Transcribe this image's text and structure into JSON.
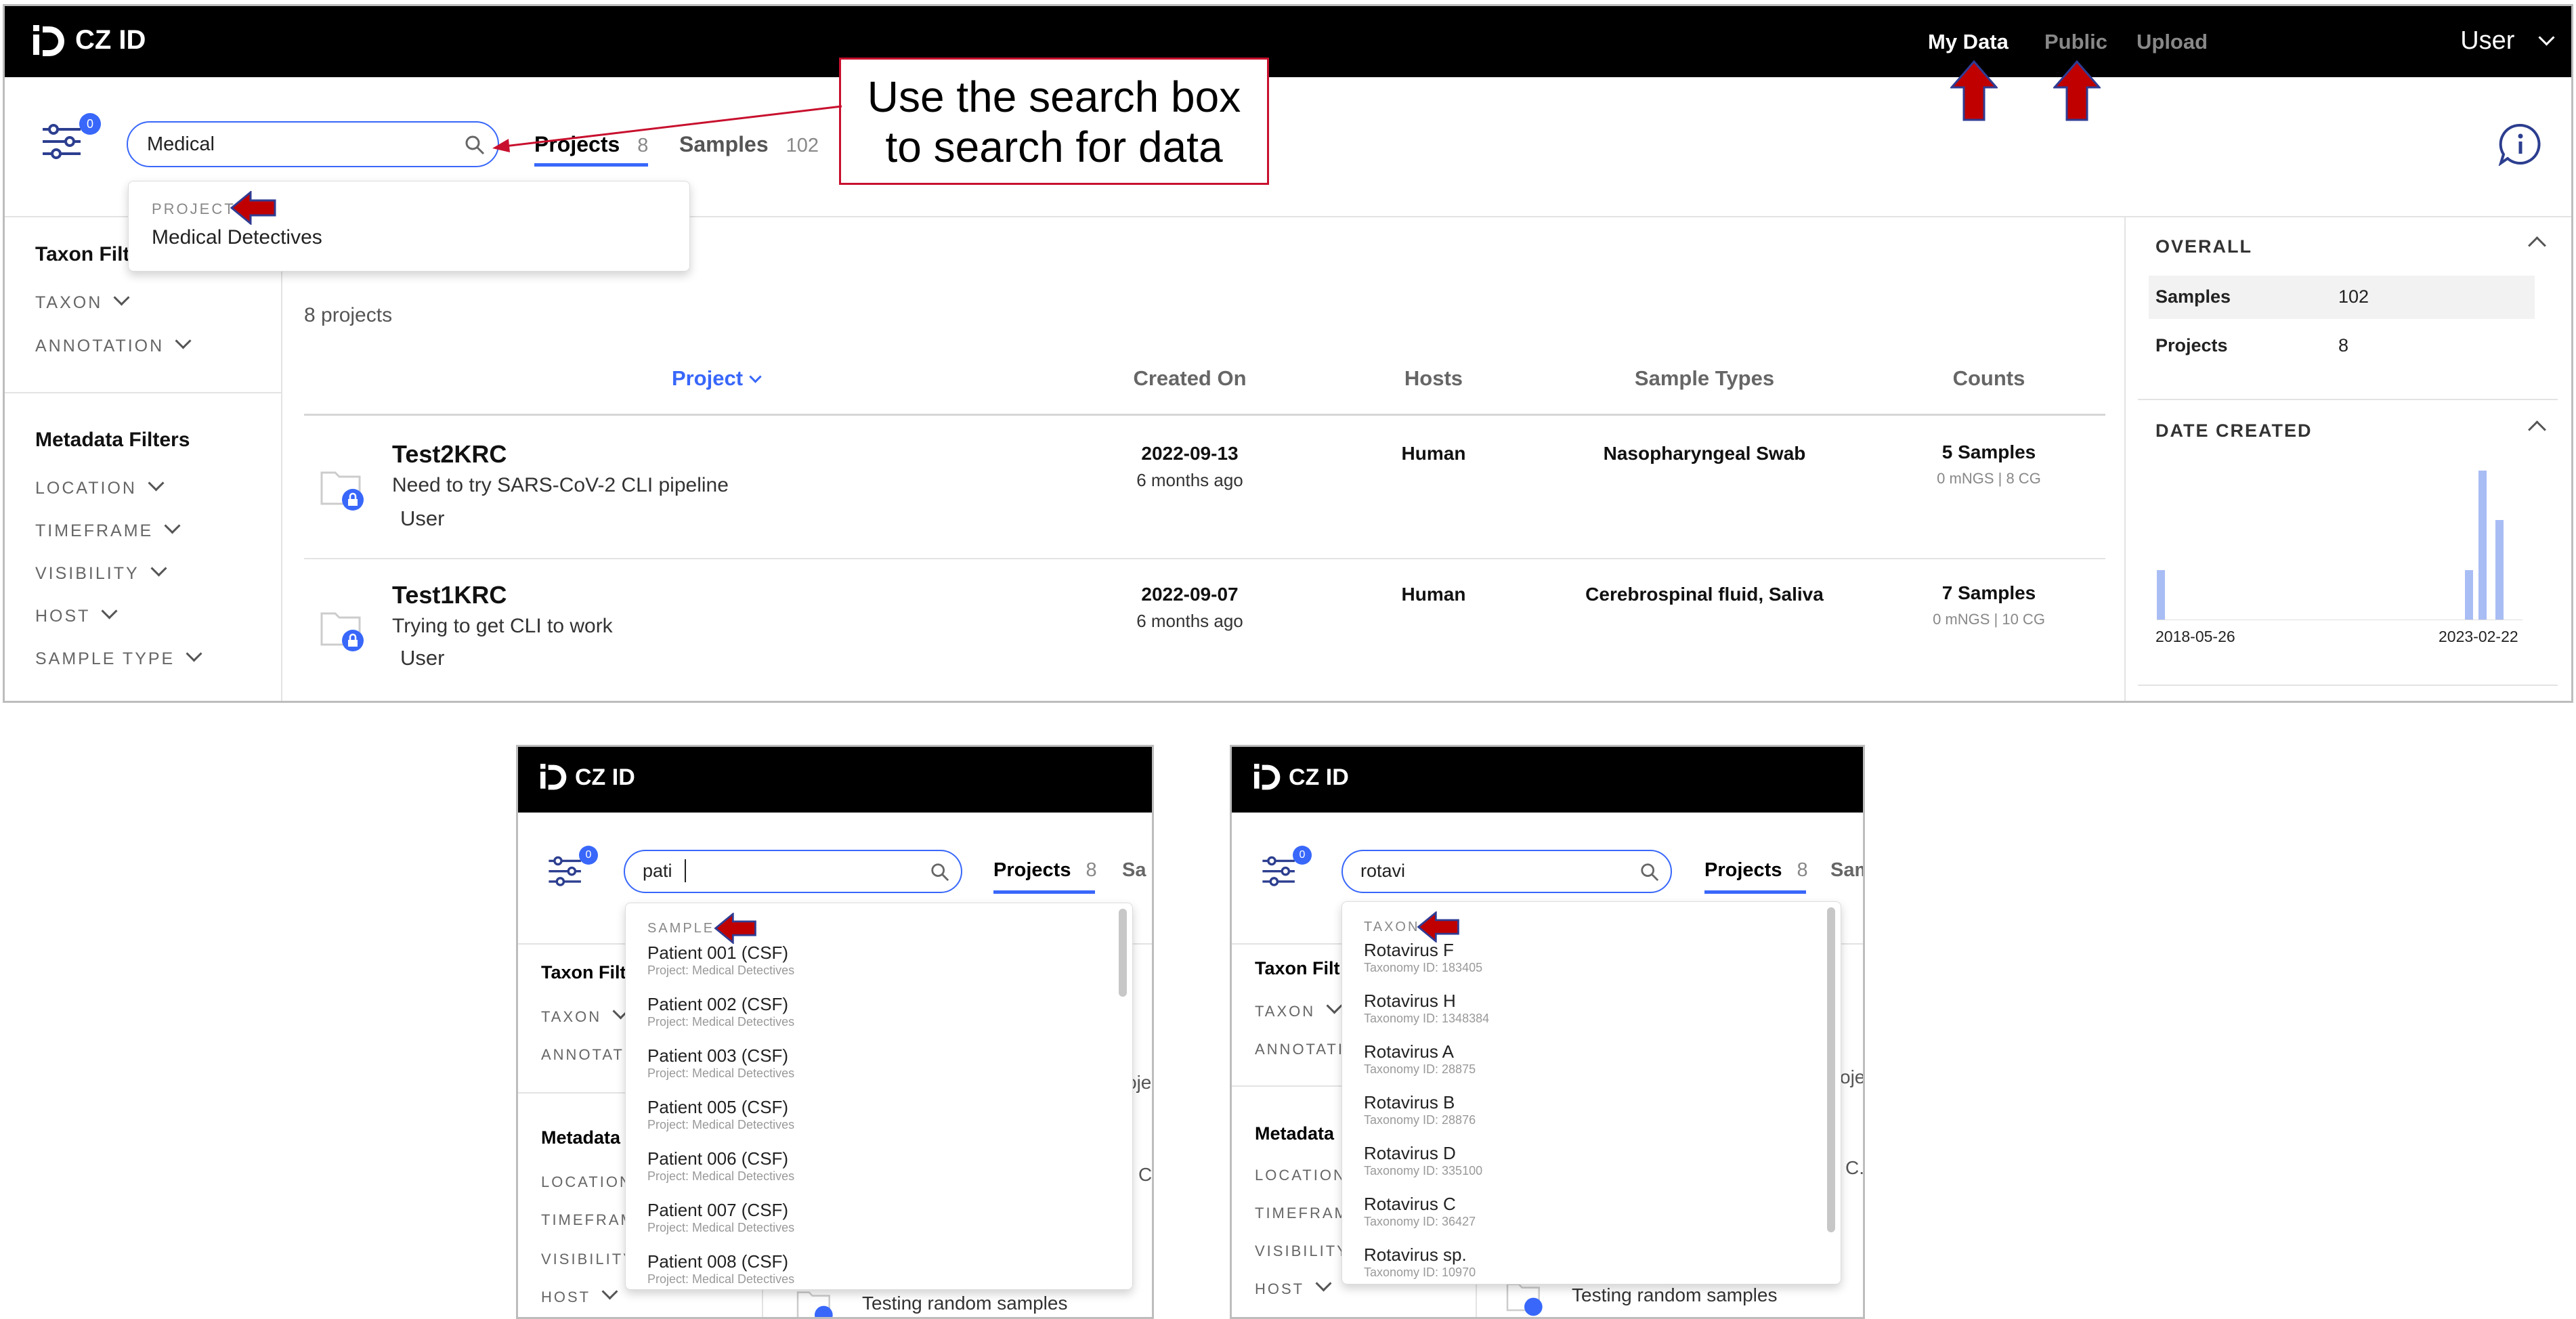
{
  "app": {
    "logo_text": "CZ ID"
  },
  "nav": {
    "my_data": "My Data",
    "public": "Public",
    "upload": "Upload",
    "user": "User"
  },
  "colors": {
    "accent": "#3867fa",
    "callout_border": "#c8102e",
    "arrow_red": "#c00000",
    "arrow_outline": "#2f3c93"
  },
  "filter_badge": "0",
  "main": {
    "search_value": "Medical",
    "tabs": [
      {
        "label": "Projects",
        "count": "8"
      },
      {
        "label": "Samples",
        "count": "102"
      }
    ],
    "dropdown": {
      "category": "PROJECT",
      "item": "Medical Detectives"
    },
    "callout_line1": "Use the search box",
    "callout_line2": "to search for data",
    "sidebar": {
      "taxon_heading": "Taxon Filt",
      "taxon_items": [
        "TAXON",
        "ANNOTATION"
      ],
      "metadata_heading": "Metadata Filters",
      "metadata_items": [
        "LOCATION",
        "TIMEFRAME",
        "VISIBILITY",
        "HOST",
        "SAMPLE TYPE"
      ]
    },
    "projects_count": "8 projects",
    "columns": [
      "Project",
      "Created On",
      "Hosts",
      "Sample Types",
      "Counts"
    ],
    "rows": [
      {
        "name": "Test2KRC",
        "desc": "Need to try SARS-CoV-2 CLI pipeline",
        "user": "User",
        "date": "2022-09-13",
        "ago": "6 months ago",
        "host": "Human",
        "types": "Nasopharyngeal Swab",
        "samples": "5 Samples",
        "sub": "0 mNGS | 8 CG"
      },
      {
        "name": "Test1KRC",
        "desc": "Trying to get CLI to work",
        "user": "User",
        "date": "2022-09-07",
        "ago": "6 months ago",
        "host": "Human",
        "types": "Cerebrospinal fluid, Saliva",
        "samples": "7 Samples",
        "sub": "0 mNGS | 10 CG"
      }
    ],
    "stats": {
      "overall_title": "OVERALL",
      "samples_label": "Samples",
      "samples_value": "102",
      "projects_label": "Projects",
      "projects_value": "8",
      "date_title": "DATE CREATED",
      "date_start": "2018-05-26",
      "date_end": "2023-02-22"
    }
  },
  "chart_data": {
    "type": "bar",
    "title": "DATE CREATED",
    "x_range": [
      "2018-05-26",
      "2023-02-22"
    ],
    "series": [
      {
        "values_relative": [
          0.33,
          0.33,
          1.0,
          0.67
        ]
      }
    ],
    "x_positions_relative": [
      0.0,
      0.91,
      0.95,
      1.0
    ]
  },
  "panel_sample": {
    "search_value": "pati",
    "tab": "Projects",
    "tab_count": "8",
    "tab2_clip": "Sa",
    "sidebar": [
      "Taxon Filt",
      "TAXON",
      "ANNOTATI",
      "Metadata",
      "LOCATION",
      "TIMEFRAM",
      "VISIBILITY",
      "HOST"
    ],
    "clip_proj": "oje",
    "clip_c": "C",
    "row_text": "Testing random samples",
    "dropdown_category": "SAMPLE",
    "items": [
      {
        "name": "Patient 001 (CSF)",
        "sub": "Project: Medical Detectives"
      },
      {
        "name": "Patient 002 (CSF)",
        "sub": "Project: Medical Detectives"
      },
      {
        "name": "Patient 003 (CSF)",
        "sub": "Project: Medical Detectives"
      },
      {
        "name": "Patient 005 (CSF)",
        "sub": "Project: Medical Detectives"
      },
      {
        "name": "Patient 006 (CSF)",
        "sub": "Project: Medical Detectives"
      },
      {
        "name": "Patient 007 (CSF)",
        "sub": "Project: Medical Detectives"
      },
      {
        "name": "Patient 008 (CSF)",
        "sub": "Project: Medical Detectives"
      }
    ]
  },
  "panel_taxon": {
    "search_value": "rotavi",
    "tab": "Projects",
    "tab_count": "8",
    "tab2_clip": "Sam",
    "sidebar": [
      "Taxon Filt",
      "TAXON",
      "ANNOTATI",
      "Metadata",
      "LOCATION",
      "TIMEFRAME",
      "VISIBILITY",
      "HOST"
    ],
    "clip_proj": "oje",
    "clip_c": "C.",
    "row_text": "Testing random samples",
    "dropdown_category": "TAXON",
    "items": [
      {
        "name": "Rotavirus F",
        "sub": "Taxonomy ID: 183405"
      },
      {
        "name": "Rotavirus H",
        "sub": "Taxonomy ID: 1348384"
      },
      {
        "name": "Rotavirus A",
        "sub": "Taxonomy ID: 28875"
      },
      {
        "name": "Rotavirus B",
        "sub": "Taxonomy ID: 28876"
      },
      {
        "name": "Rotavirus D",
        "sub": "Taxonomy ID: 335100"
      },
      {
        "name": "Rotavirus C",
        "sub": "Taxonomy ID: 36427"
      },
      {
        "name": "Rotavirus sp.",
        "sub": "Taxonomy ID: 10970"
      }
    ]
  }
}
